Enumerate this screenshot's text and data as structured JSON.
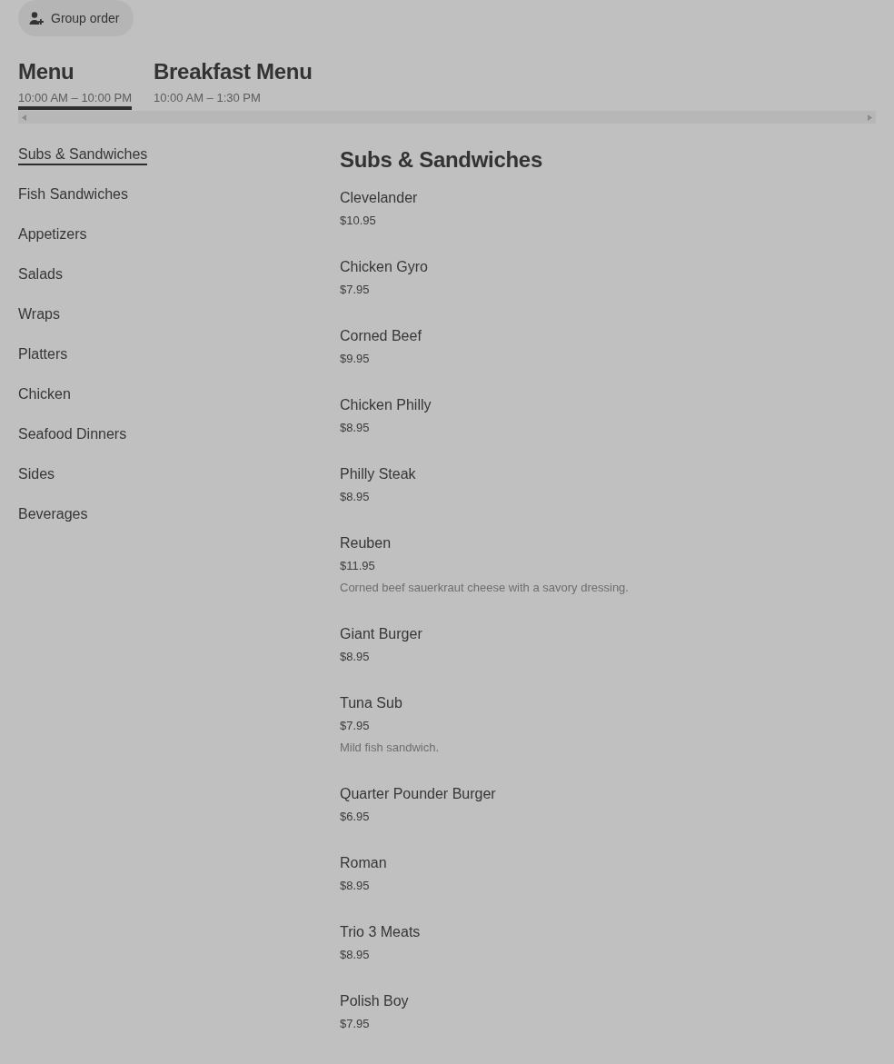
{
  "header": {
    "group_order_button": "Group order"
  },
  "menu_tabs": [
    {
      "title": "Menu",
      "hours": "10:00 AM – 10:00 PM",
      "selected": true
    },
    {
      "title": "Breakfast Menu",
      "hours": "10:00 AM – 1:30 PM",
      "selected": false
    }
  ],
  "categories": [
    {
      "label": "Subs & Sandwiches",
      "selected": true
    },
    {
      "label": "Fish Sandwiches",
      "selected": false
    },
    {
      "label": "Appetizers",
      "selected": false
    },
    {
      "label": "Salads",
      "selected": false
    },
    {
      "label": "Wraps",
      "selected": false
    },
    {
      "label": "Platters",
      "selected": false
    },
    {
      "label": "Chicken",
      "selected": false
    },
    {
      "label": "Seafood Dinners",
      "selected": false
    },
    {
      "label": "Sides",
      "selected": false
    },
    {
      "label": "Beverages",
      "selected": false
    }
  ],
  "section": {
    "title": "Subs & Sandwiches",
    "items": [
      {
        "name": "Clevelander",
        "price": "$10.95"
      },
      {
        "name": "Chicken Gyro",
        "price": "$7.95"
      },
      {
        "name": "Corned Beef",
        "price": "$9.95"
      },
      {
        "name": "Chicken Philly",
        "price": "$8.95"
      },
      {
        "name": "Philly Steak",
        "price": "$8.95"
      },
      {
        "name": "Reuben",
        "price": "$11.95",
        "description": "Corned beef sauerkraut cheese with a savory dressing."
      },
      {
        "name": "Giant Burger",
        "price": "$8.95"
      },
      {
        "name": "Tuna Sub",
        "price": "$7.95",
        "description": "Mild fish sandwich."
      },
      {
        "name": "Quarter Pounder Burger",
        "price": "$6.95"
      },
      {
        "name": "Roman",
        "price": "$8.95"
      },
      {
        "name": "Trio 3 Meats",
        "price": "$8.95"
      },
      {
        "name": "Polish Boy",
        "price": "$7.95"
      }
    ]
  }
}
